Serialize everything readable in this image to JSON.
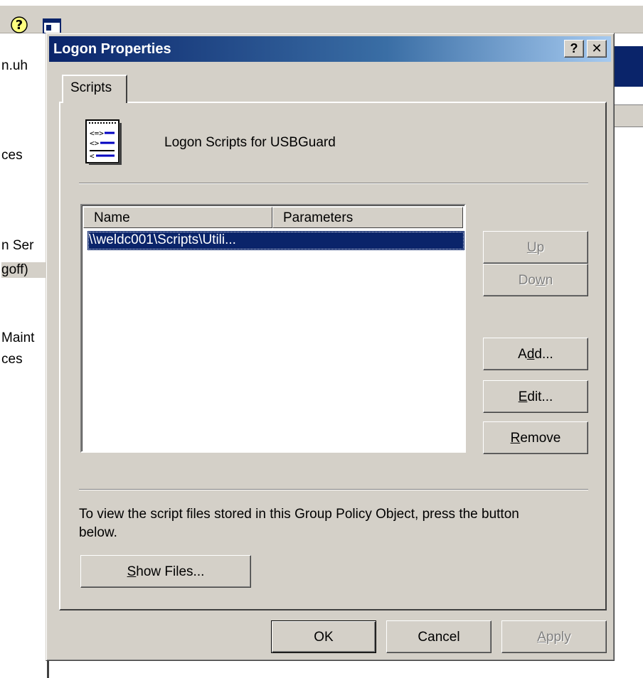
{
  "background_window": {
    "left_items": [
      "n.uh",
      "ces",
      "n Ser",
      "goff)",
      "Maint",
      "ces"
    ]
  },
  "dialog": {
    "title": "Logon Properties",
    "help_button": "?",
    "close_button": "✕",
    "tab": "Scripts",
    "heading": "Logon Scripts for USBGuard",
    "list": {
      "columns": [
        "Name",
        "Parameters"
      ],
      "rows": [
        {
          "name": "\\\\weldc001\\Scripts\\Utili...",
          "parameters": ""
        }
      ]
    },
    "buttons": {
      "up": {
        "pre": "",
        "key": "U",
        "post": "p"
      },
      "down": {
        "pre": "Do",
        "key": "w",
        "post": "n"
      },
      "add": {
        "pre": "A",
        "key": "d",
        "post": "d..."
      },
      "edit": {
        "pre": "",
        "key": "E",
        "post": "dit..."
      },
      "remove": {
        "pre": "",
        "key": "R",
        "post": "emove"
      },
      "show_files": {
        "pre": "",
        "key": "S",
        "post": "how Files..."
      },
      "ok": "OK",
      "cancel": "Cancel",
      "apply": {
        "pre": "",
        "key": "A",
        "post": "pply"
      }
    },
    "info_text": "To view the script files stored in this Group Policy Object, press the button below."
  }
}
